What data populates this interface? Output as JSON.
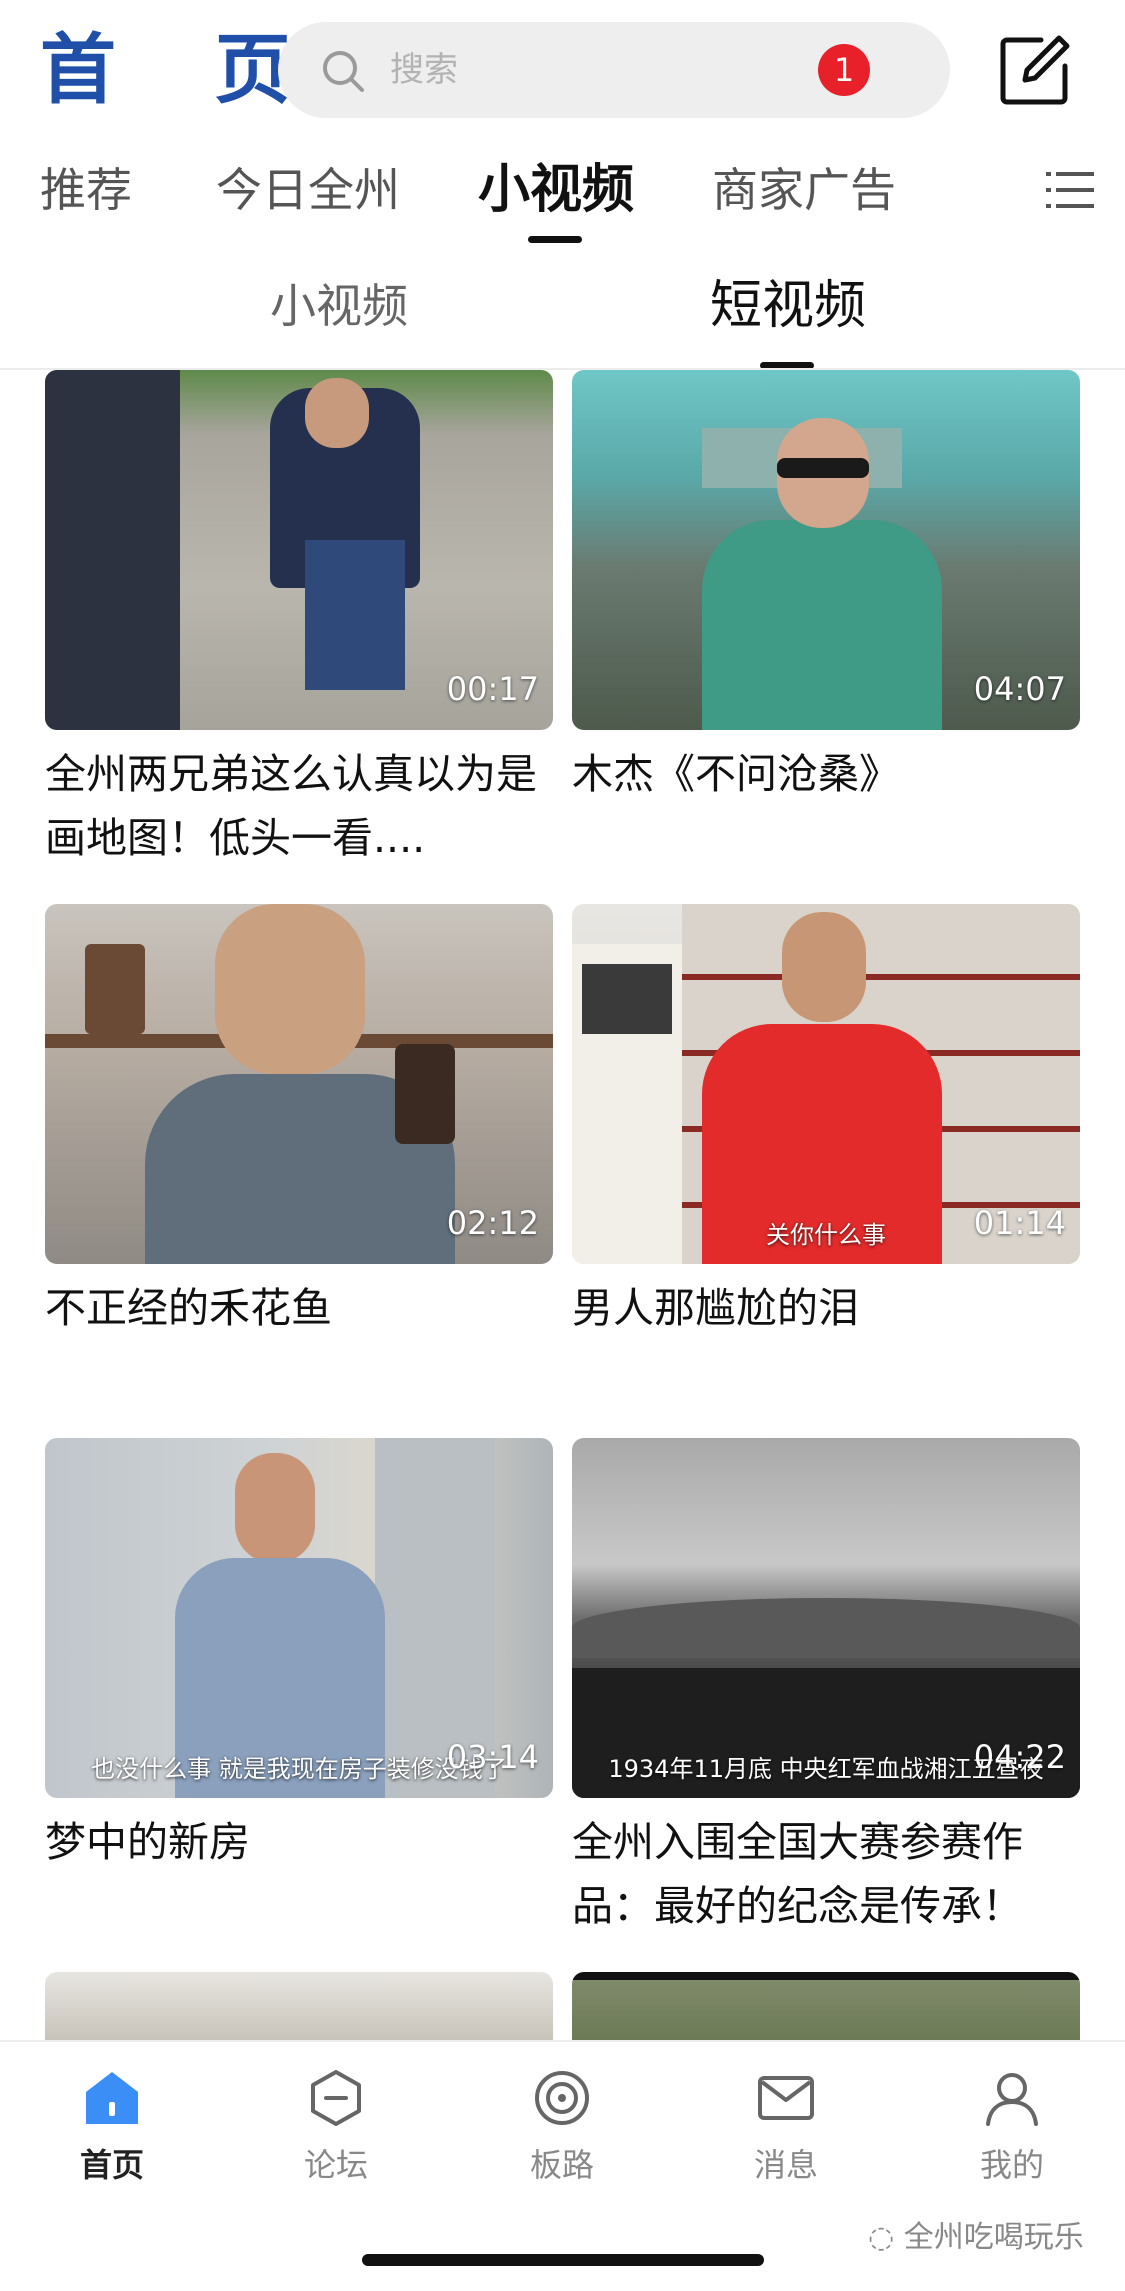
{
  "header": {
    "logo": "首 页",
    "search_placeholder": "搜索"
  },
  "top_tabs": [
    {
      "label": "推荐",
      "active": false
    },
    {
      "label": "今日全州",
      "active": false
    },
    {
      "label": "小视频",
      "active": true
    },
    {
      "label": "商家广告",
      "active": false
    }
  ],
  "sub_tabs": [
    {
      "label": "小视频",
      "active": false
    },
    {
      "label": "短视频",
      "active": true
    }
  ],
  "videos": [
    {
      "title": "全州两兄弟这么认真以为是画地图！低头一看....",
      "duration": "00:17",
      "subtitle": ""
    },
    {
      "title": "木杰《不问沧桑》",
      "duration": "04:07",
      "subtitle": ""
    },
    {
      "title": "不正经的禾花鱼",
      "duration": "02:12",
      "subtitle": ""
    },
    {
      "title": "男人那尴尬的泪",
      "duration": "01:14",
      "subtitle": "关你什么事"
    },
    {
      "title": "梦中的新房",
      "duration": "03:14",
      "subtitle": "也没什么事 就是我现在房子装修没钱了"
    },
    {
      "title": "全州入围全国大赛参赛作品：最好的纪念是传承！",
      "duration": "04:22",
      "subtitle": "1934年11月底 中央红军血战湘江五昼夜"
    }
  ],
  "bottom_nav": [
    {
      "label": "首页",
      "icon": "home-icon",
      "active": true
    },
    {
      "label": "论坛",
      "icon": "forum-icon",
      "active": false
    },
    {
      "label": "板路",
      "icon": "banlu-icon",
      "active": false
    },
    {
      "label": "消息",
      "icon": "message-icon",
      "active": false,
      "badge": "1"
    },
    {
      "label": "我的",
      "icon": "profile-icon",
      "active": false
    }
  ],
  "watermark": "全州吃喝玩乐",
  "colors": {
    "brand": "#1f4fa8",
    "badge": "#e8202a",
    "home_active": "#3a8ef6"
  }
}
